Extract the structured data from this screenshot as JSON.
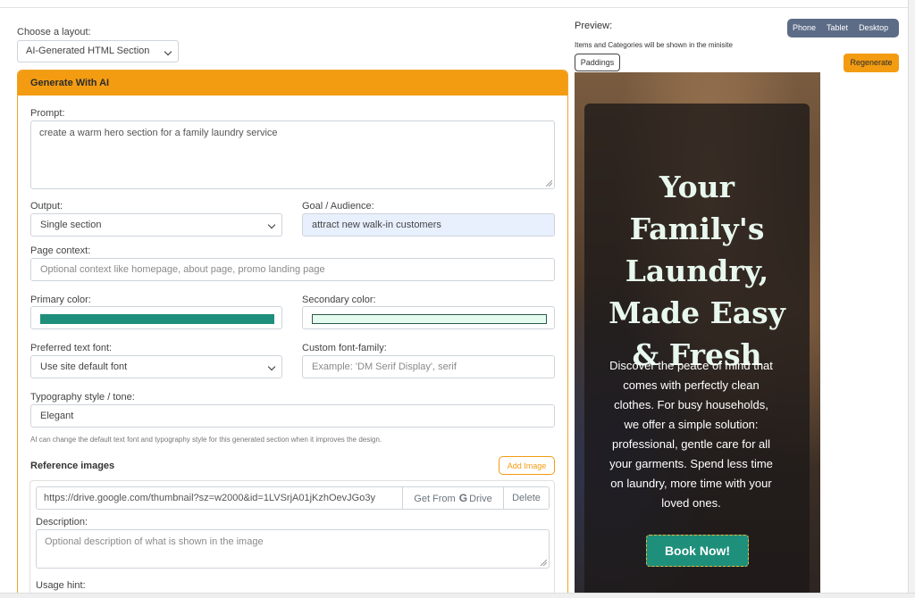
{
  "layout": {
    "label": "Choose a layout:",
    "selected": "AI-Generated HTML Section"
  },
  "panel": {
    "title": "Generate With AI"
  },
  "prompt": {
    "label": "Prompt:",
    "value": "create a warm hero section for a family laundry service"
  },
  "output": {
    "label": "Output:",
    "selected": "Single section"
  },
  "goal": {
    "label": "Goal / Audience:",
    "value": "attract new walk-in customers"
  },
  "page_context": {
    "label": "Page context:",
    "placeholder": "Optional context like homepage, about page, promo landing page"
  },
  "primary_color": {
    "label": "Primary color:",
    "value": "#1e8f7a"
  },
  "secondary_color": {
    "label": "Secondary color:",
    "value": "#e6fbef"
  },
  "text_font": {
    "label": "Preferred text font:",
    "selected": "Use site default font"
  },
  "custom_font": {
    "label": "Custom font-family:",
    "placeholder": "Example: 'DM Serif Display', serif"
  },
  "typography": {
    "label": "Typography style / tone:",
    "value": "Elegant"
  },
  "typography_hint": "AI can change the default text font and typography style for this generated section when it improves the design.",
  "reference": {
    "title": "Reference images",
    "add_label": "Add Image",
    "url": "https://drive.google.com/thumbnail?sz=w2000&id=1LVSrjA01jKzhOevJGo3y",
    "drive_label_prefix": "Get From",
    "drive_g": "G",
    "drive_label": "Drive",
    "delete_label": "Delete",
    "description_label": "Description:",
    "description_placeholder": "Optional description of what is shown in the image",
    "usage_label": "Usage hint:"
  },
  "preview": {
    "label": "Preview:",
    "note": "Items and Categories will be shown in the minisite",
    "devices": [
      "Phone",
      "Tablet",
      "Desktop"
    ],
    "paddings_label": "Paddings",
    "regenerate_label": "Regenerate"
  },
  "hero": {
    "title_lines": [
      "Your",
      "Family's",
      "Laundry,",
      "Made Easy",
      "& Fresh"
    ],
    "subtitle_lines": [
      "Discover the peace of mind that",
      "comes with perfectly clean",
      "clothes. For busy households,",
      "we offer a simple solution:",
      "professional, gentle care for all",
      "your garments. Spend less time",
      "on laundry, more time with your",
      "loved ones."
    ],
    "cta": "Book Now!"
  },
  "colors": {
    "accent": "#f39c12",
    "device_bar": "#5c6c86",
    "cta": "#1e8f7a",
    "cta_border": "#f3b73a"
  }
}
